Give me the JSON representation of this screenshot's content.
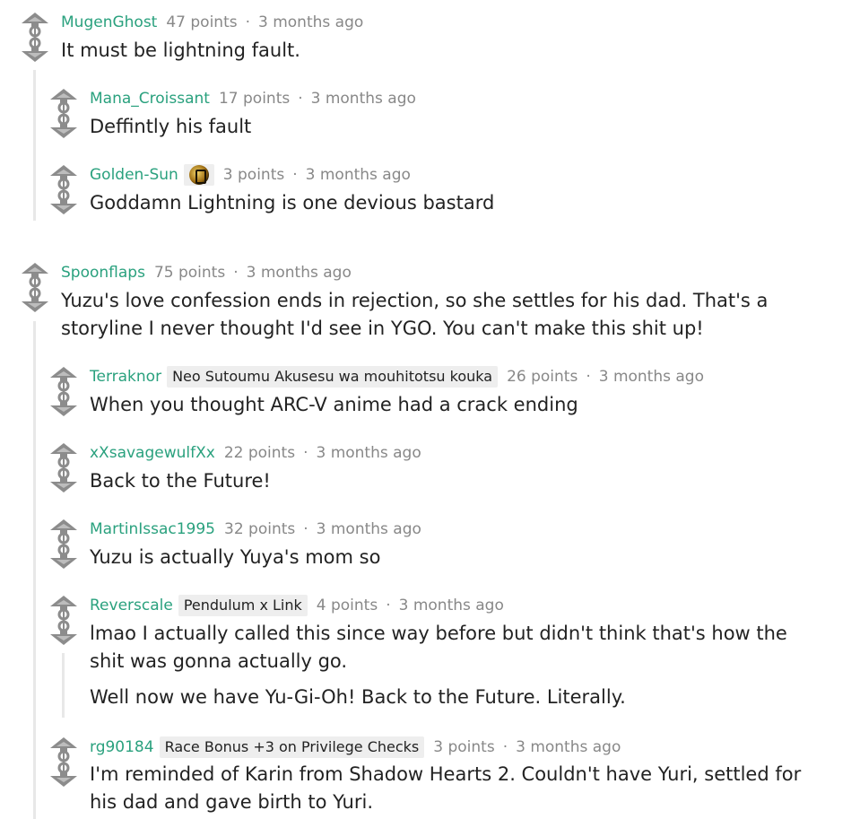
{
  "comments": [
    {
      "user": "MugenGhost",
      "flair": "",
      "points": "47 points",
      "time": "3 months ago",
      "body": [
        "It must be lightning fault."
      ]
    },
    {
      "user": "Mana_Croissant",
      "flair": "",
      "points": "17 points",
      "time": "3 months ago",
      "body": [
        "Deffintly his fault"
      ]
    },
    {
      "user": "Golden-Sun",
      "flair": "",
      "points": "3 points",
      "time": "3 months ago",
      "body": [
        "Goddamn Lightning is one devious bastard"
      ]
    },
    {
      "user": "Spoonflaps",
      "flair": "",
      "points": "75 points",
      "time": "3 months ago",
      "body": [
        "Yuzu's love confession ends in rejection, so she settles for his dad. That's a storyline I never thought I'd see in YGO. You can't make this shit up!"
      ]
    },
    {
      "user": "Terraknor",
      "flair": "Neo Sutoumu Akusesu wa mouhitotsu kouka",
      "points": "26 points",
      "time": "3 months ago",
      "body": [
        "When you thought ARC-V anime had a crack ending"
      ]
    },
    {
      "user": "xXsavagewulfXx",
      "flair": "",
      "points": "22 points",
      "time": "3 months ago",
      "body": [
        "Back to the Future!"
      ]
    },
    {
      "user": "MartinIssac1995",
      "flair": "",
      "points": "32 points",
      "time": "3 months ago",
      "body": [
        "Yuzu is actually Yuya's mom so"
      ]
    },
    {
      "user": "Reverscale",
      "flair": "Pendulum x Link",
      "points": "4 points",
      "time": "3 months ago",
      "body": [
        "lmao I actually called this since way before but didn't think that's how the shit was gonna actually go.",
        "Well now we have Yu-Gi-Oh! Back to the Future. Literally."
      ]
    },
    {
      "user": "rg90184",
      "flair": "Race Bonus +3 on Privilege Checks",
      "points": "3 points",
      "time": "3 months ago",
      "body": [
        "I'm reminded of Karin from Shadow Hearts 2. Couldn't have Yuri, settled for his dad and gave birth to Yuri."
      ]
    }
  ],
  "icons": {
    "upvote": "upvote-icon",
    "downvote": "downvote-icon",
    "flair_image": "golden-sun-flair-icon"
  },
  "colors": {
    "username": "#2aa17e",
    "meta": "#888888",
    "flair_bg": "#eeeeee",
    "rail": "#e8e8e8"
  }
}
